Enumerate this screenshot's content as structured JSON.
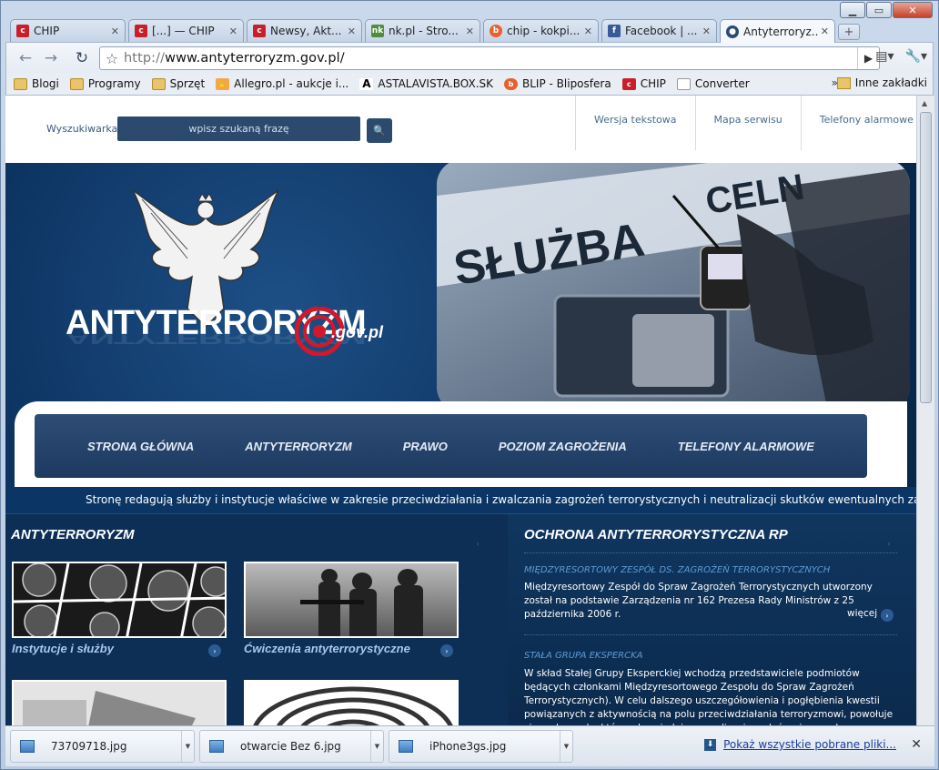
{
  "browser": {
    "tabs": [
      {
        "title": "CHIP",
        "favicon": "chip-icon",
        "color": "#c8202a"
      },
      {
        "title": "[...] — CHIP",
        "favicon": "chip-icon",
        "color": "#c8202a"
      },
      {
        "title": "Newsy, Akt...",
        "favicon": "chip-icon",
        "color": "#c8202a"
      },
      {
        "title": "nk.pl - Stro...",
        "favicon": "nk-icon",
        "color": "#4f8d3a"
      },
      {
        "title": "chip - kokpi...",
        "favicon": "blip-icon",
        "color": "#e8612c"
      },
      {
        "title": "Facebook | ...",
        "favicon": "facebook-icon",
        "color": "#3b5998"
      },
      {
        "title": "Antyterroryz...",
        "favicon": "site-icon",
        "color": "#2a4a78"
      }
    ],
    "url_prefix": "http://",
    "url_host": "www.antyterroryzm.gov.pl/",
    "bookmarks": [
      {
        "label": "Blogi",
        "type": "folder"
      },
      {
        "label": "Programy",
        "type": "folder"
      },
      {
        "label": "Sprzęt",
        "type": "folder"
      },
      {
        "label": "Allegro.pl - aukcje i...",
        "type": "link"
      },
      {
        "label": "ASTALAVISTA.BOX.SK",
        "type": "link"
      },
      {
        "label": "BLIP - Bliposfera",
        "type": "link"
      },
      {
        "label": "CHIP",
        "type": "link"
      },
      {
        "label": "Converter",
        "type": "link"
      }
    ],
    "bookmarks_more": "»",
    "other_bookmarks": "Inne zakładki"
  },
  "site": {
    "search_label": "Wyszukiwarka:",
    "search_placeholder": "wpisz szukaną frazę",
    "top_links": [
      "Wersja tekstowa",
      "Mapa serwisu",
      "Telefony alarmowe"
    ],
    "logo_main": "ANTYTERRORYZM",
    "logo_suffix": ".gov.pl",
    "hero_sign": "SŁUŻBA",
    "hero_sign2": "CELN",
    "nav": [
      "STRONA GŁÓWNA",
      "ANTYTERRORYZM",
      "PRAWO",
      "POZIOM ZAGROŻENIA",
      "TELEFONY ALARMOWE"
    ],
    "ticker": "Stronę redagują służby i instytucje właściwe w zakresie przeciwdziałania i zwalczania zagrożeń terrorystycznych i neutralizacji skutków ewentualnych zamachów, członkowie Międzyresortowego Zespołu",
    "left_heading": "ANTYTERRORYZM",
    "tiles": [
      {
        "caption": "Instytucje i służby"
      },
      {
        "caption": "Ćwiczenia antyterrorystyczne"
      }
    ],
    "right_heading": "OCHRONA ANTYTERRORYSTYCZNA RP",
    "articles": [
      {
        "title": "MIĘDZYRESORTOWY ZESPÓŁ DS. ZAGROŻEŃ TERRORYSTYCZNYCH",
        "text": "Międzyresortowy Zespół do Spraw Zagrożeń Terrorystycznych utworzony został na podstawie Zarządzenia nr 162 Prezesa Rady Ministrów z 25 października 2006 r.",
        "more": "więcej"
      },
      {
        "title": "STAŁA GRUPA EKSPERCKA",
        "text": "W skład Stałej Grupy Eksperckiej wchodzą przedstawiciele podmiotów będących członkami Międzyresortowego Zespołu do Spraw Zagrożeń Terrorystycznych). W celu dalszego uszczegółowienia i pogłębienia kwestii powiązanych z aktywnością na polu przeciwdziałania terroryzmowi, powołuje się podzespoły, które odpowiadają za realizację zadań związanych z konkretnymi wyzwaniami w dziedzinie ochrony"
      }
    ]
  },
  "downloads": {
    "items": [
      "73709718.jpg",
      "otwarcie Bez 6.jpg",
      "iPhone3gs.jpg"
    ],
    "show_all": "Pokaż wszystkie pobrane pliki..."
  }
}
